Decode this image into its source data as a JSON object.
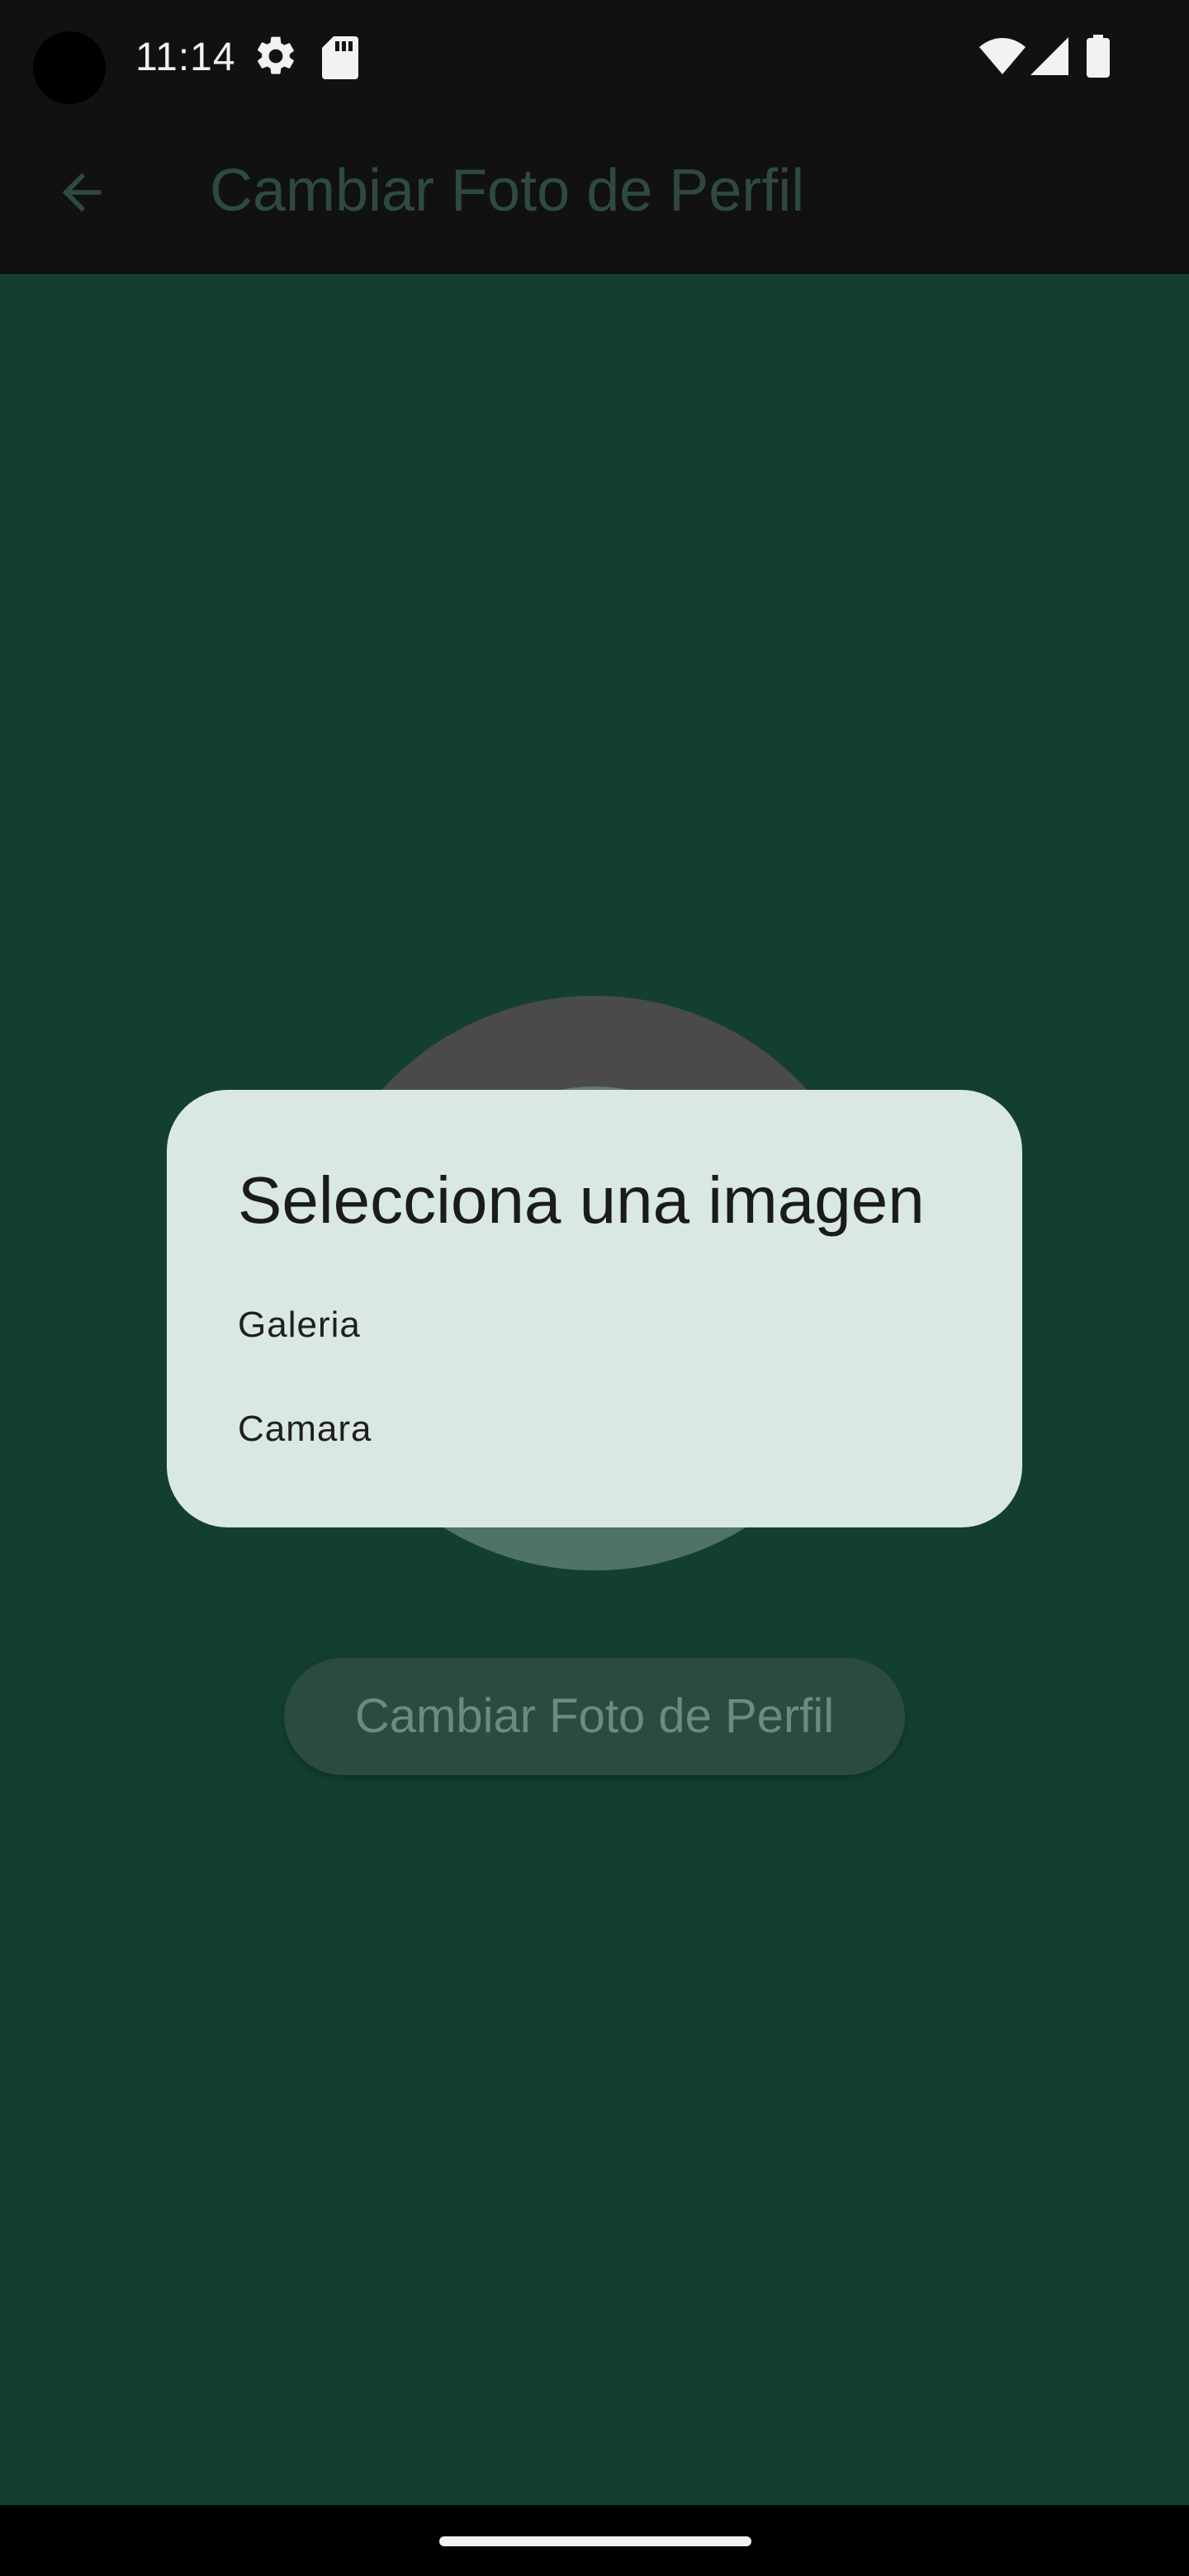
{
  "status_bar": {
    "time": "11:14",
    "icons": [
      "settings-gear-icon",
      "sd-card-icon",
      "wifi-icon",
      "cell-signal-icon",
      "battery-icon"
    ]
  },
  "app_bar": {
    "title": "Cambiar Foto de Perfil",
    "back_icon": "arrow-back-icon"
  },
  "main": {
    "change_photo_button_label": "Cambiar Foto de Perfil"
  },
  "dialog": {
    "title": "Selecciona una imagen",
    "options": [
      {
        "label": "Galeria"
      },
      {
        "label": "Camara"
      }
    ]
  },
  "colors": {
    "content_background": "#133f32",
    "dialog_background": "#d9e8e1",
    "status_bar_background": "#111111"
  }
}
